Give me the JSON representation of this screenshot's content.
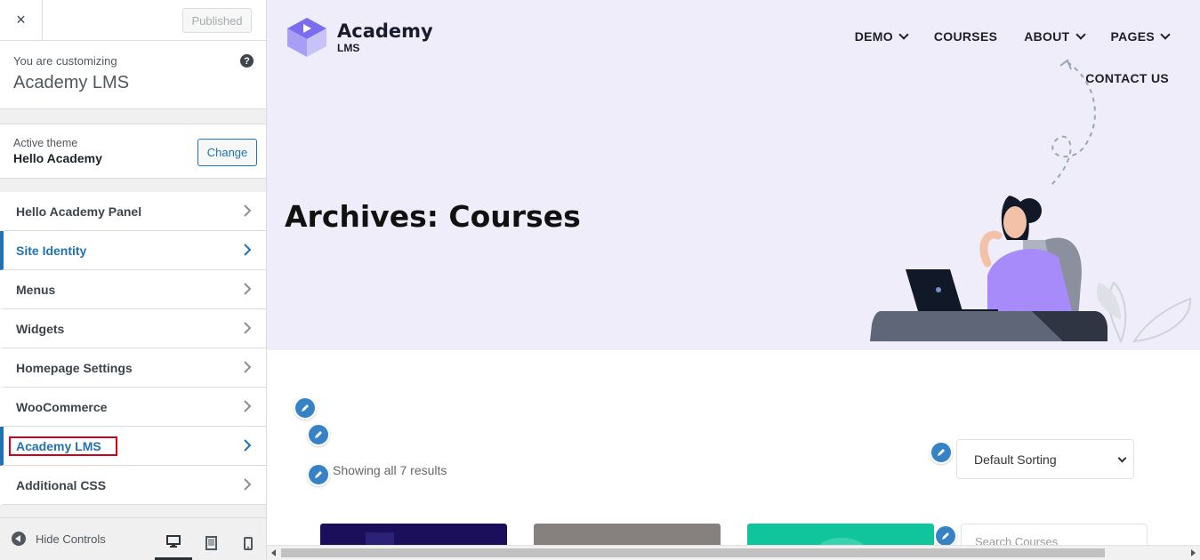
{
  "sidebar": {
    "close_icon": "×",
    "published_label": "Published",
    "customizing_label": "You are customizing",
    "site_name": "Academy LMS",
    "help_icon": "?",
    "active_theme_label": "Active theme",
    "active_theme_name": "Hello Academy",
    "change_label": "Change",
    "items": [
      {
        "label": "Hello Academy Panel"
      },
      {
        "label": "Site Identity"
      },
      {
        "label": "Menus"
      },
      {
        "label": "Widgets"
      },
      {
        "label": "Homepage Settings"
      },
      {
        "label": "WooCommerce"
      },
      {
        "label": "Academy LMS"
      },
      {
        "label": "Additional CSS"
      }
    ],
    "hide_controls_label": "Hide Controls"
  },
  "preview": {
    "logo": {
      "title": "Academy",
      "subtitle": "LMS"
    },
    "nav": {
      "demo": "DEMO",
      "courses": "COURSES",
      "about": "ABOUT",
      "pages": "PAGES",
      "contact": "CONTACT US"
    },
    "page_title": "Archives: Courses",
    "results_text": "Showing all 7 results",
    "sort_value": "Default Sorting",
    "search_placeholder": "Search Courses",
    "colors": {
      "hero_bg": "#efedfa",
      "accent": "#2271b1",
      "edit_pen": "#3582c4",
      "logo_purple": "#7c6cf0"
    }
  }
}
